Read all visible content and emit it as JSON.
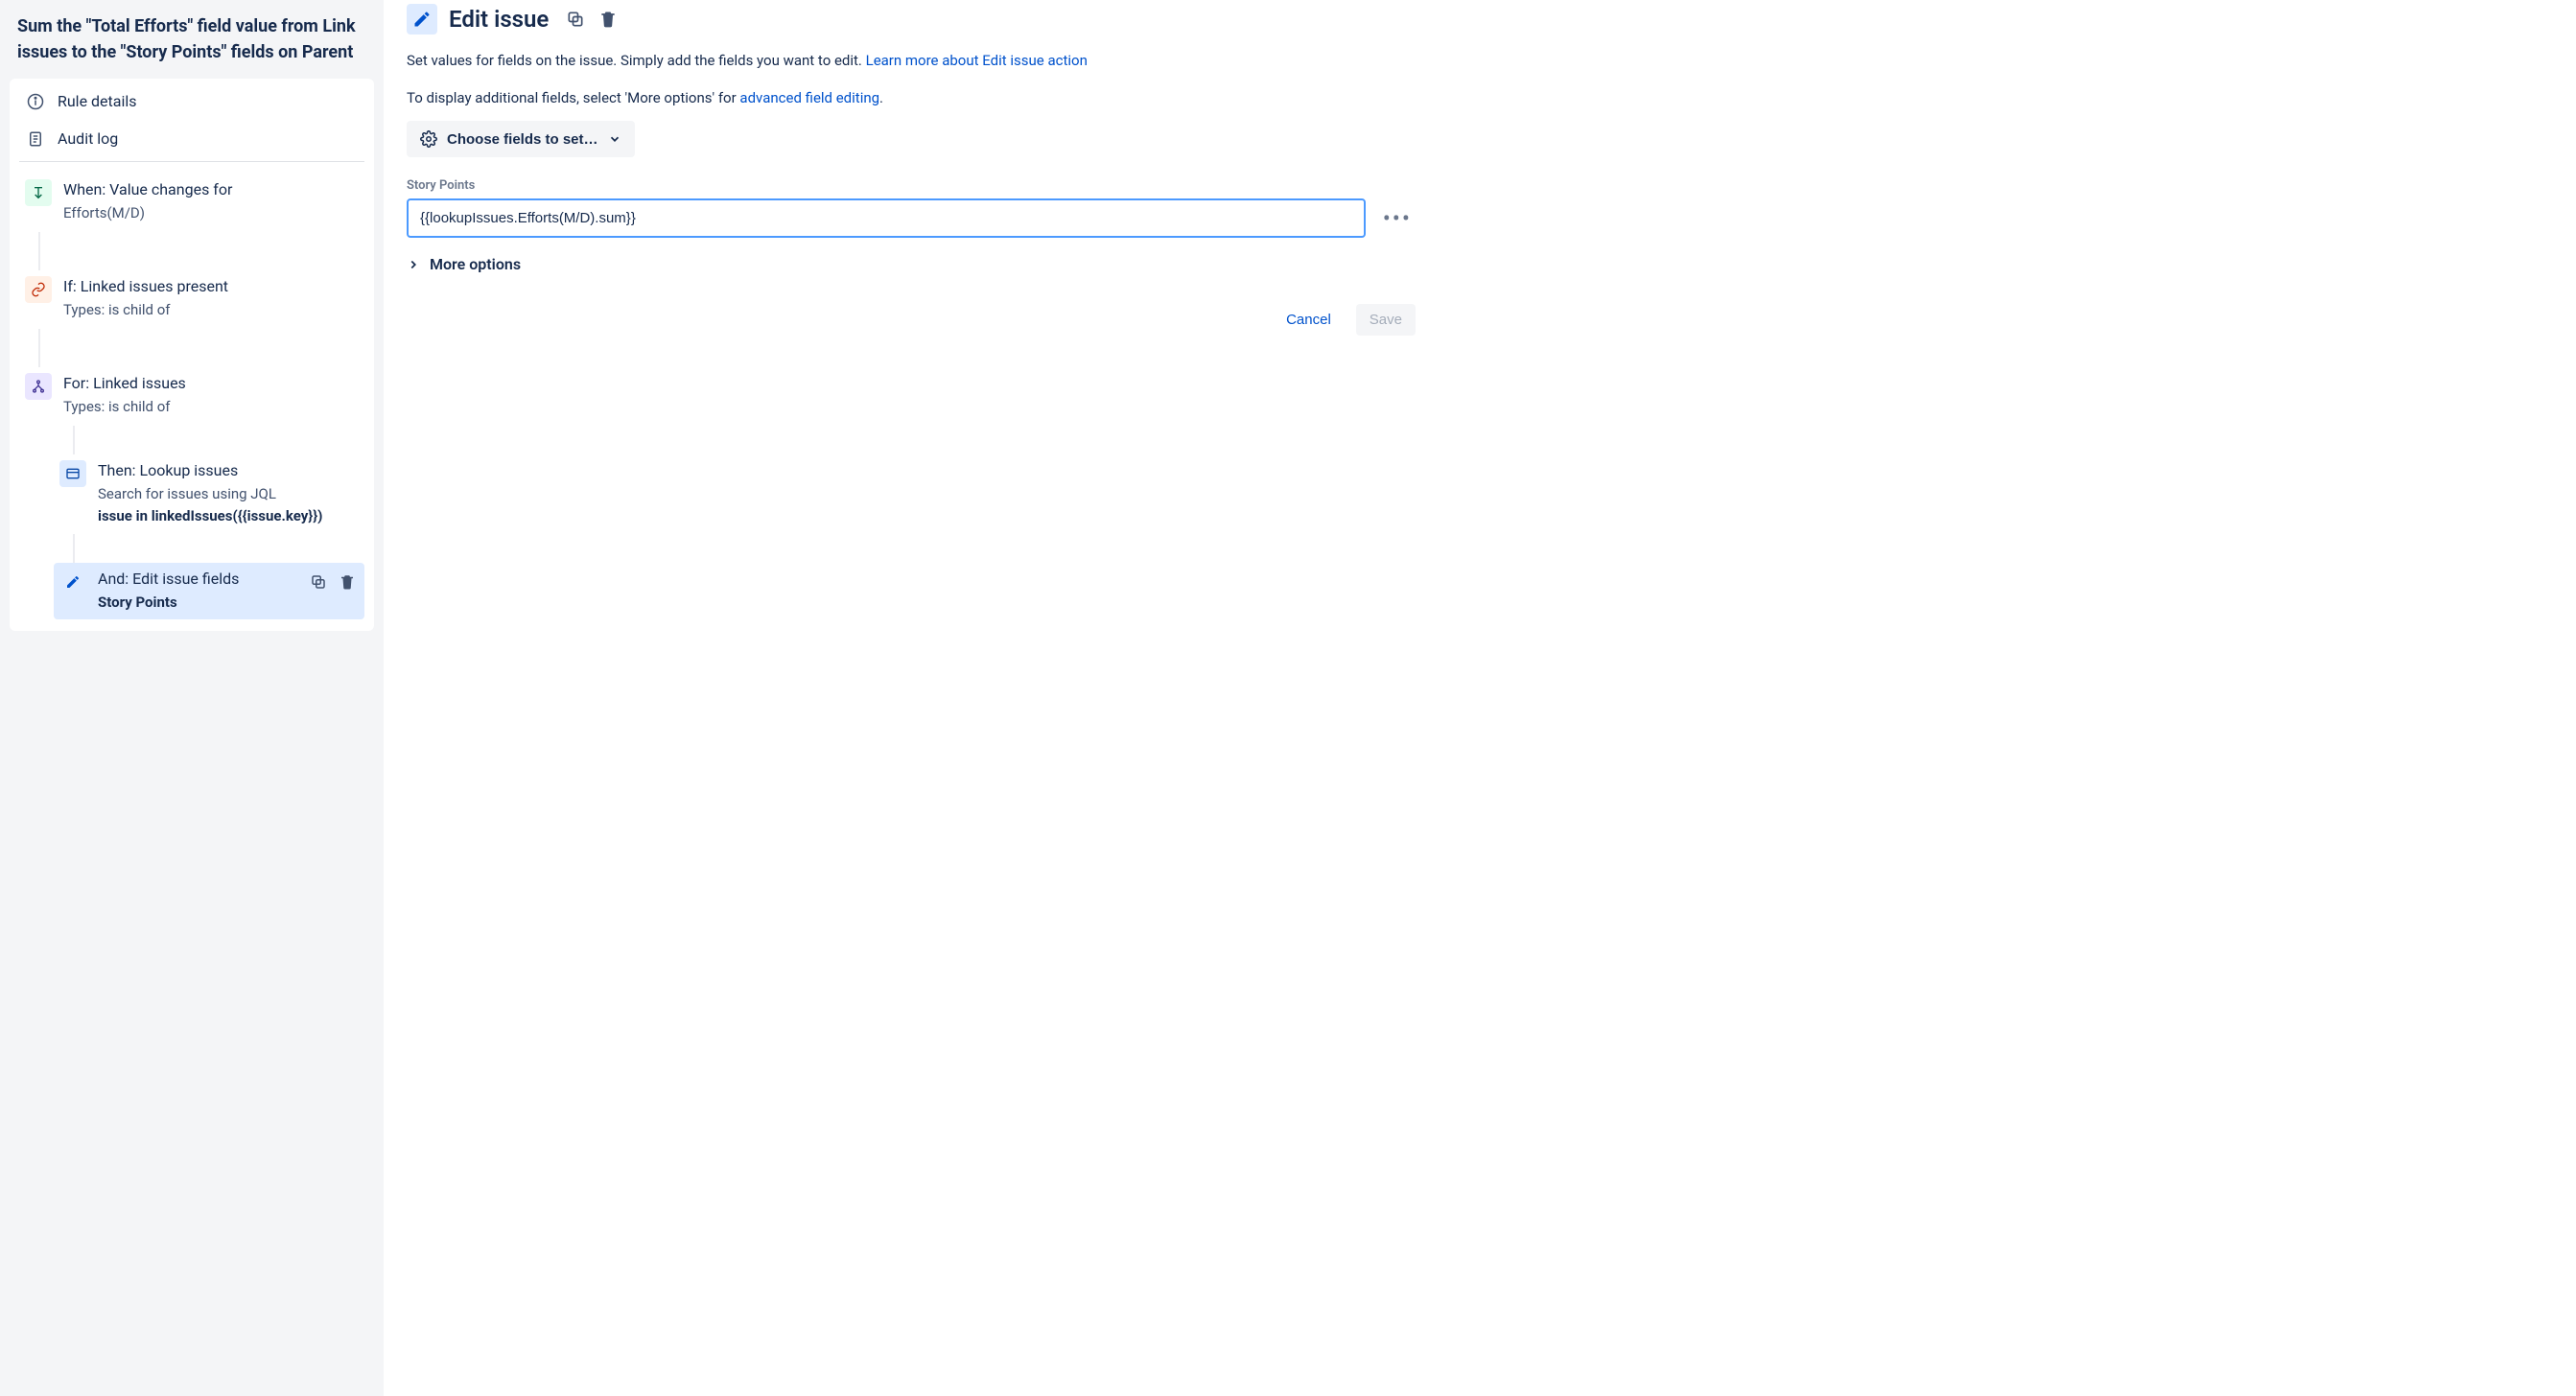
{
  "sidebar": {
    "rule_title": "Sum the \"Total Efforts\" field value from Link issues to the \"Story Points\" fields on Parent",
    "nav": {
      "rule_details": "Rule details",
      "audit_log": "Audit log"
    },
    "steps": {
      "trigger": {
        "title": "When: Value changes for",
        "sub": "Efforts(M/D)"
      },
      "condition": {
        "title": "If: Linked issues present",
        "sub": "Types: is child of"
      },
      "branch": {
        "title": "For: Linked issues",
        "sub": "Types: is child of"
      },
      "lookup": {
        "title": "Then: Lookup issues",
        "sub_line1": "Search for issues using JQL",
        "sub_line2_bold": "issue in linkedIssues({{issue.key}})"
      },
      "edit": {
        "title": "And: Edit issue fields",
        "sub_bold": "Story Points"
      }
    }
  },
  "main": {
    "title": "Edit issue",
    "desc1_a": "Set values for fields on the issue. Simply add the fields you want to edit. ",
    "desc1_link": "Learn more about Edit issue action",
    "desc2_a": "To display additional fields, select 'More options' for ",
    "desc2_link": "advanced field editing",
    "desc2_b": ".",
    "choose_fields_label": "Choose fields to set…",
    "field": {
      "label": "Story Points",
      "value": "{{lookupIssues.Efforts(M/D).sum}}"
    },
    "more_options": "More options",
    "cancel": "Cancel",
    "save": "Save"
  }
}
